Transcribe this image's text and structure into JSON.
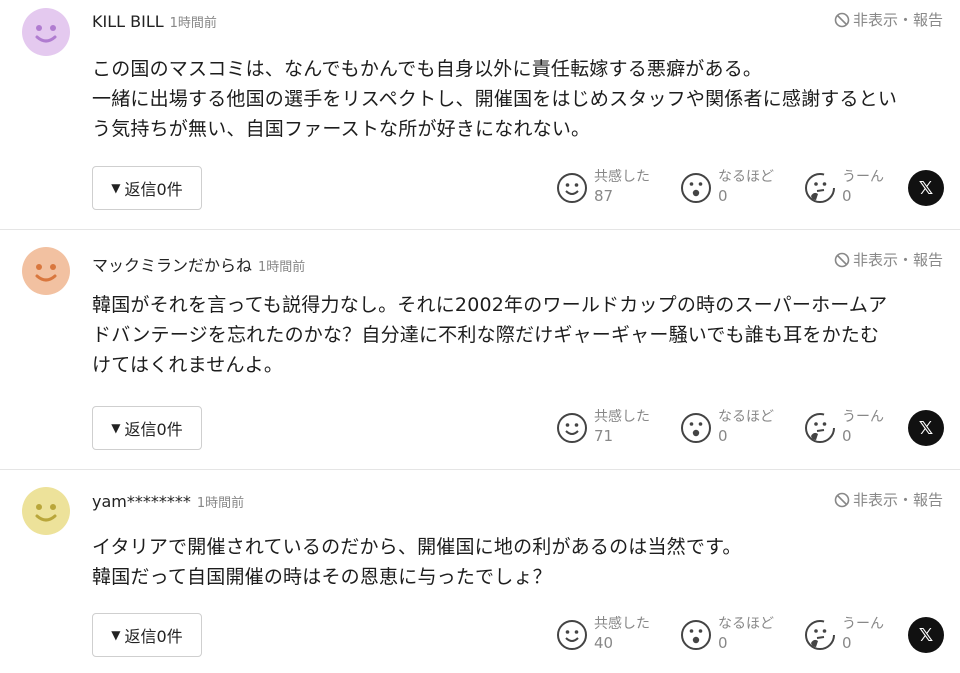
{
  "comments": [
    {
      "author": "KILL BILL",
      "time": "1時間前",
      "report": "非表示・報告",
      "avatar_color": "#e4c9ef",
      "body": [
        "この国のマスコミは、なんでもかんでも自身以外に責任転嫁する悪癖がある。",
        "一緒に出場する他国の選手をリスペクトし、開催国をはじめスタッフや関係者に感謝するとい",
        "う気持ちが無い、自国ファーストな所が好きになれない。"
      ],
      "reply_label": "返信0件",
      "reactions": [
        {
          "label": "共感した",
          "count": "87"
        },
        {
          "label": "なるほど",
          "count": "0"
        },
        {
          "label": "うーん",
          "count": "0"
        }
      ]
    },
    {
      "author": "マックミランだからね",
      "time": "1時間前",
      "report": "非表示・報告",
      "avatar_color": "#f2c1a1",
      "body": [
        "韓国がそれを言っても説得力なし。それに2002年のワールドカップの時のスーパーホームア",
        "ドバンテージを忘れたのかな？自分達に不利な際だけギャーギャー騒いでも誰も耳をかたむ",
        "けてはくれませんよ。"
      ],
      "reply_label": "返信0件",
      "reactions": [
        {
          "label": "共感した",
          "count": "71"
        },
        {
          "label": "なるほど",
          "count": "0"
        },
        {
          "label": "うーん",
          "count": "0"
        }
      ]
    },
    {
      "author": "yam********",
      "time": "1時間前",
      "report": "非表示・報告",
      "avatar_color": "#ede29a",
      "body": [
        "イタリアで開催されているのだから、開催国に地の利があるのは当然です。",
        "韓国だって自国開催の時はその恩恵に与ったでしょ？"
      ],
      "reply_label": "返信0件",
      "reactions": [
        {
          "label": "共感した",
          "count": "40"
        },
        {
          "label": "なるほど",
          "count": "0"
        },
        {
          "label": "うーん",
          "count": "0"
        }
      ]
    }
  ],
  "icons": {
    "report": "ban-icon",
    "reply": "triangle-down-icon",
    "reactions": [
      "smile-icon",
      "surprised-icon",
      "thinking-icon"
    ],
    "share": "x-logo-icon"
  },
  "x_label": "𝕏"
}
